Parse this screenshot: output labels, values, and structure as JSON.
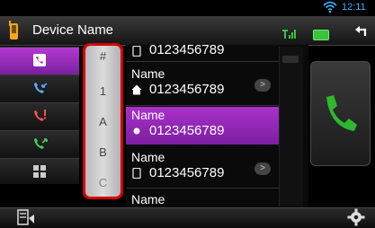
{
  "status": {
    "time": "12:11"
  },
  "header": {
    "title": "Device Name"
  },
  "index_letters": [
    "#",
    "1",
    "A",
    "B",
    "C"
  ],
  "contacts": [
    {
      "name": "",
      "number": "0123456789",
      "icon": "mobile-icon",
      "selected": false
    },
    {
      "name": "Name",
      "number": "0123456789",
      "icon": "home-icon",
      "selected": false
    },
    {
      "name": "Name",
      "number": "0123456789",
      "icon": "dot-icon",
      "selected": true
    },
    {
      "name": "Name",
      "number": "0123456789",
      "icon": "mobile-icon",
      "selected": false
    },
    {
      "name": "Name",
      "number": "",
      "icon": "",
      "selected": false
    }
  ],
  "row_button": ">",
  "colors": {
    "accent": "#a931c8",
    "highlight_border": "#d60000",
    "clock": "#3ab0ff",
    "call": "#2eb82e"
  }
}
